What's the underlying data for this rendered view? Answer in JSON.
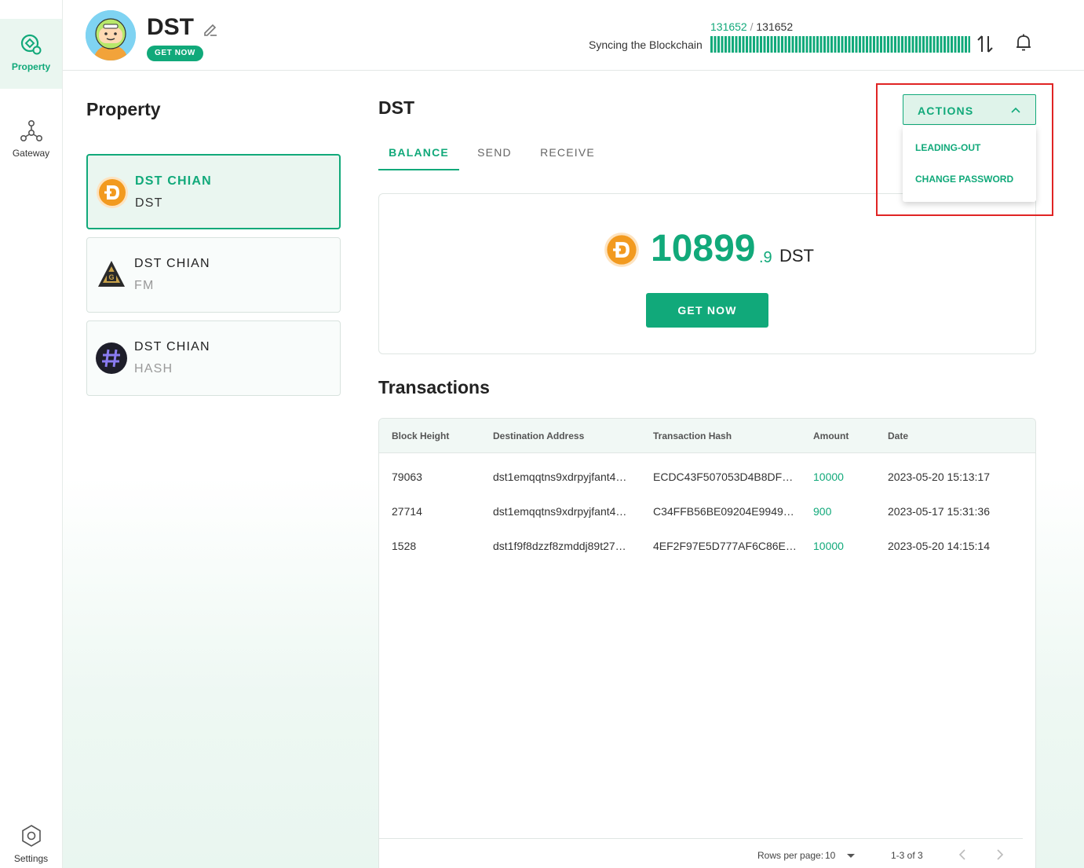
{
  "sidebar": {
    "items": [
      {
        "label": "Property",
        "icon": "property-icon"
      },
      {
        "label": "Gateway",
        "icon": "gateway-icon"
      },
      {
        "label": "Settings",
        "icon": "settings-icon"
      }
    ]
  },
  "header": {
    "title": "DST",
    "get_now": "GET NOW",
    "sync_current": "131652",
    "sync_sep": "/",
    "sync_total": "131652",
    "sync_label": "Syncing the Blockchain"
  },
  "property": {
    "title": "Property",
    "assets": [
      {
        "name": "DST CHIAN",
        "symbol": "DST"
      },
      {
        "name": "DST CHIAN",
        "symbol": "FM"
      },
      {
        "name": "DST CHIAN",
        "symbol": "HASH"
      }
    ]
  },
  "asset": {
    "title": "DST",
    "tabs": [
      "BALANCE",
      "SEND",
      "RECEIVE"
    ],
    "balance_int": "10899",
    "balance_dec": ".9",
    "balance_unit": "DST",
    "get_now": "GET NOW"
  },
  "actions": {
    "label": "ACTIONS",
    "menu": [
      "LEADING-OUT",
      "CHANGE PASSWORD"
    ]
  },
  "transactions": {
    "title": "Transactions",
    "columns": [
      "Block Height",
      "Destination Address",
      "Transaction Hash",
      "Amount",
      "Date"
    ],
    "rows": [
      [
        "79063",
        "dst1emqqtns9xdrpyjfant4…",
        "ECDC43F507053D4B8DF…",
        "10000",
        "2023-05-20 15:13:17"
      ],
      [
        "27714",
        "dst1emqqtns9xdrpyjfant4…",
        "C34FFB56BE09204E9949…",
        "900",
        "2023-05-17 15:31:36"
      ],
      [
        "1528",
        "dst1f9f8dzzf8zmddj89t27…",
        "4EF2F97E5D777AF6C86E…",
        "10000",
        "2023-05-20 14:15:14"
      ]
    ],
    "rows_per_page_label": "Rows per page:",
    "rows_per_page": "10",
    "range": "1-3 of 3"
  },
  "colors": {
    "accent": "#11a97a",
    "highlight": "#e02424"
  }
}
